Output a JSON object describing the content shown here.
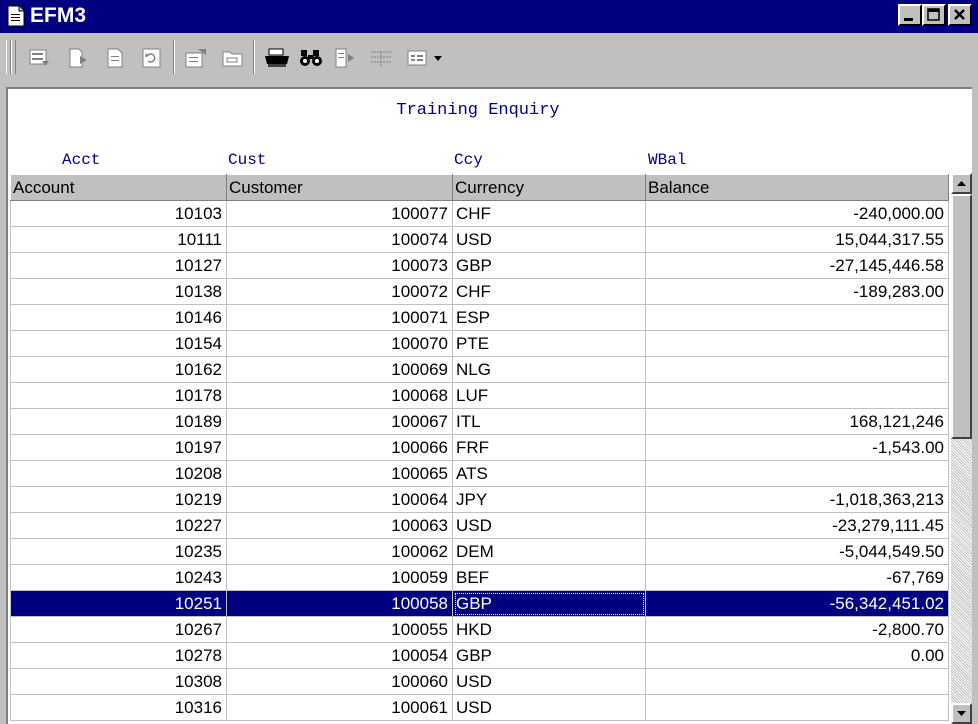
{
  "window": {
    "title": "EFM3"
  },
  "toolbar": {
    "icons": [
      "form-view-icon",
      "record-forward-icon",
      "record-icon",
      "refresh-icon",
      "properties-icon",
      "folder-icon",
      "print-icon",
      "find-icon",
      "next-page-icon",
      "grid-lines-icon",
      "layout-icon"
    ]
  },
  "report": {
    "title": "Training Enquiry",
    "field_labels": {
      "acct": "Acct",
      "cust": "Cust",
      "ccy": "Ccy",
      "wbal": "WBal"
    }
  },
  "grid": {
    "columns": [
      "Account",
      "Customer",
      "Currency",
      "Balance"
    ],
    "rows": [
      {
        "account": "10103",
        "customer": "100077",
        "currency": "CHF",
        "balance": "-240,000.00"
      },
      {
        "account": "10111",
        "customer": "100074",
        "currency": "USD",
        "balance": "15,044,317.55"
      },
      {
        "account": "10127",
        "customer": "100073",
        "currency": "GBP",
        "balance": "-27,145,446.58"
      },
      {
        "account": "10138",
        "customer": "100072",
        "currency": "CHF",
        "balance": "-189,283.00"
      },
      {
        "account": "10146",
        "customer": "100071",
        "currency": "ESP",
        "balance": ""
      },
      {
        "account": "10154",
        "customer": "100070",
        "currency": "PTE",
        "balance": ""
      },
      {
        "account": "10162",
        "customer": "100069",
        "currency": "NLG",
        "balance": ""
      },
      {
        "account": "10178",
        "customer": "100068",
        "currency": "LUF",
        "balance": ""
      },
      {
        "account": "10189",
        "customer": "100067",
        "currency": "ITL",
        "balance": "168,121,246"
      },
      {
        "account": "10197",
        "customer": "100066",
        "currency": "FRF",
        "balance": "-1,543.00"
      },
      {
        "account": "10208",
        "customer": "100065",
        "currency": "ATS",
        "balance": ""
      },
      {
        "account": "10219",
        "customer": "100064",
        "currency": "JPY",
        "balance": "-1,018,363,213"
      },
      {
        "account": "10227",
        "customer": "100063",
        "currency": "USD",
        "balance": "-23,279,111.45"
      },
      {
        "account": "10235",
        "customer": "100062",
        "currency": "DEM",
        "balance": "-5,044,549.50"
      },
      {
        "account": "10243",
        "customer": "100059",
        "currency": "BEF",
        "balance": "-67,769"
      },
      {
        "account": "10251",
        "customer": "100058",
        "currency": "GBP",
        "balance": "-56,342,451.02"
      },
      {
        "account": "10267",
        "customer": "100055",
        "currency": "HKD",
        "balance": "-2,800.70"
      },
      {
        "account": "10278",
        "customer": "100054",
        "currency": "GBP",
        "balance": "0.00"
      },
      {
        "account": "10308",
        "customer": "100060",
        "currency": "USD",
        "balance": ""
      },
      {
        "account": "10316",
        "customer": "100061",
        "currency": "USD",
        "balance": ""
      }
    ],
    "selected_account": "10251"
  },
  "colors": {
    "titlebar": "#000080",
    "selection": "#000080",
    "report_text": "#000080"
  }
}
